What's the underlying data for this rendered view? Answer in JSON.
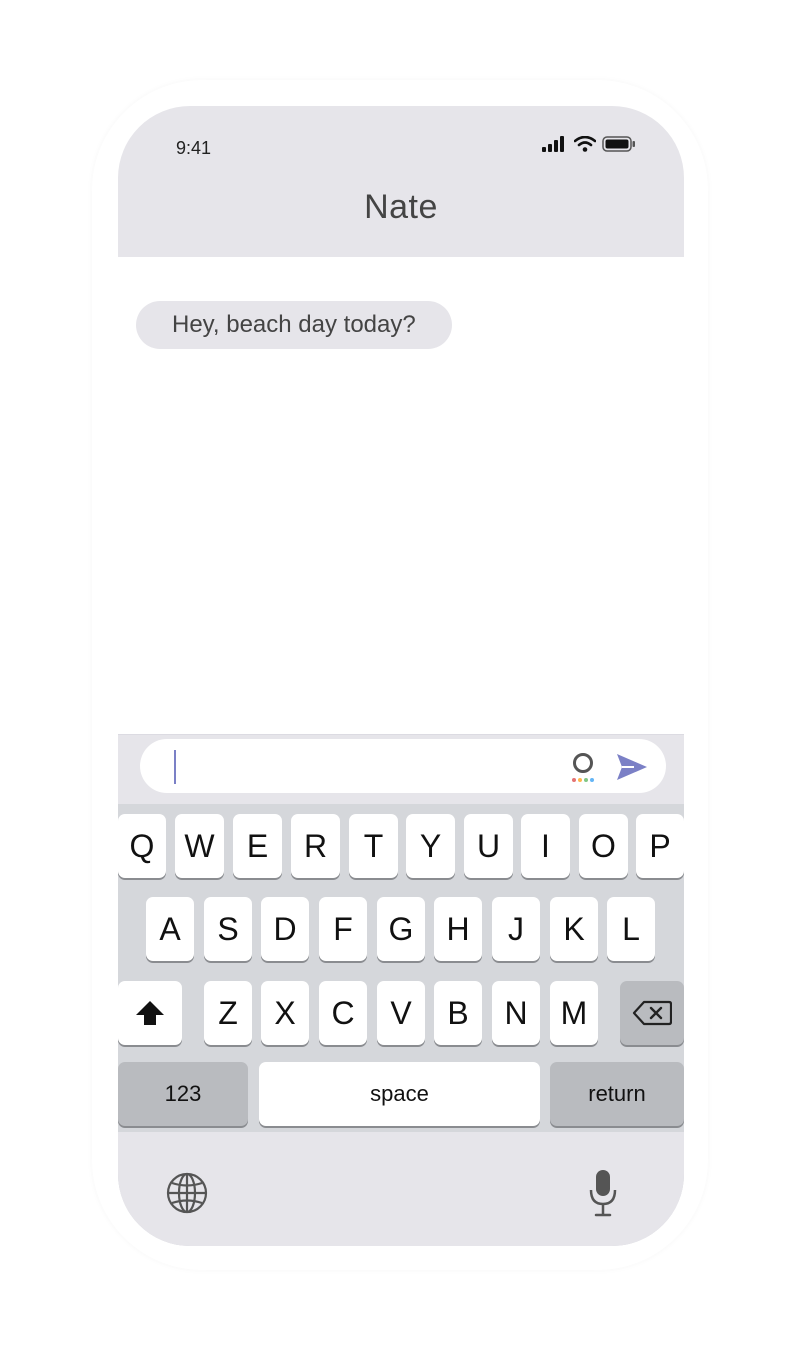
{
  "status_bar": {
    "time": "9:41"
  },
  "header": {
    "contact_name": "Nate"
  },
  "messages": [
    {
      "text": "Hey, beach day today?"
    }
  ],
  "composer": {
    "value": ""
  },
  "keyboard": {
    "row1": [
      "Q",
      "W",
      "E",
      "R",
      "T",
      "Y",
      "U",
      "I",
      "O",
      "P"
    ],
    "row2": [
      "A",
      "S",
      "D",
      "F",
      "G",
      "H",
      "J",
      "K",
      "L"
    ],
    "row3": [
      "Z",
      "X",
      "C",
      "V",
      "B",
      "N",
      "M"
    ],
    "numbers_label": "123",
    "space_label": "space",
    "return_label": "return"
  },
  "icons": {
    "signal": "cellular-signal-icon",
    "wifi": "wifi-icon",
    "battery": "battery-icon",
    "shift": "shift-icon",
    "delete": "backspace-icon",
    "globe": "globe-icon",
    "mic": "microphone-icon",
    "send": "send-icon",
    "assistant": "grammarly-icon"
  },
  "colors": {
    "accent": "#7b80c6",
    "bubble": "#e6e5ea",
    "keyboard": "#d5d7db"
  }
}
